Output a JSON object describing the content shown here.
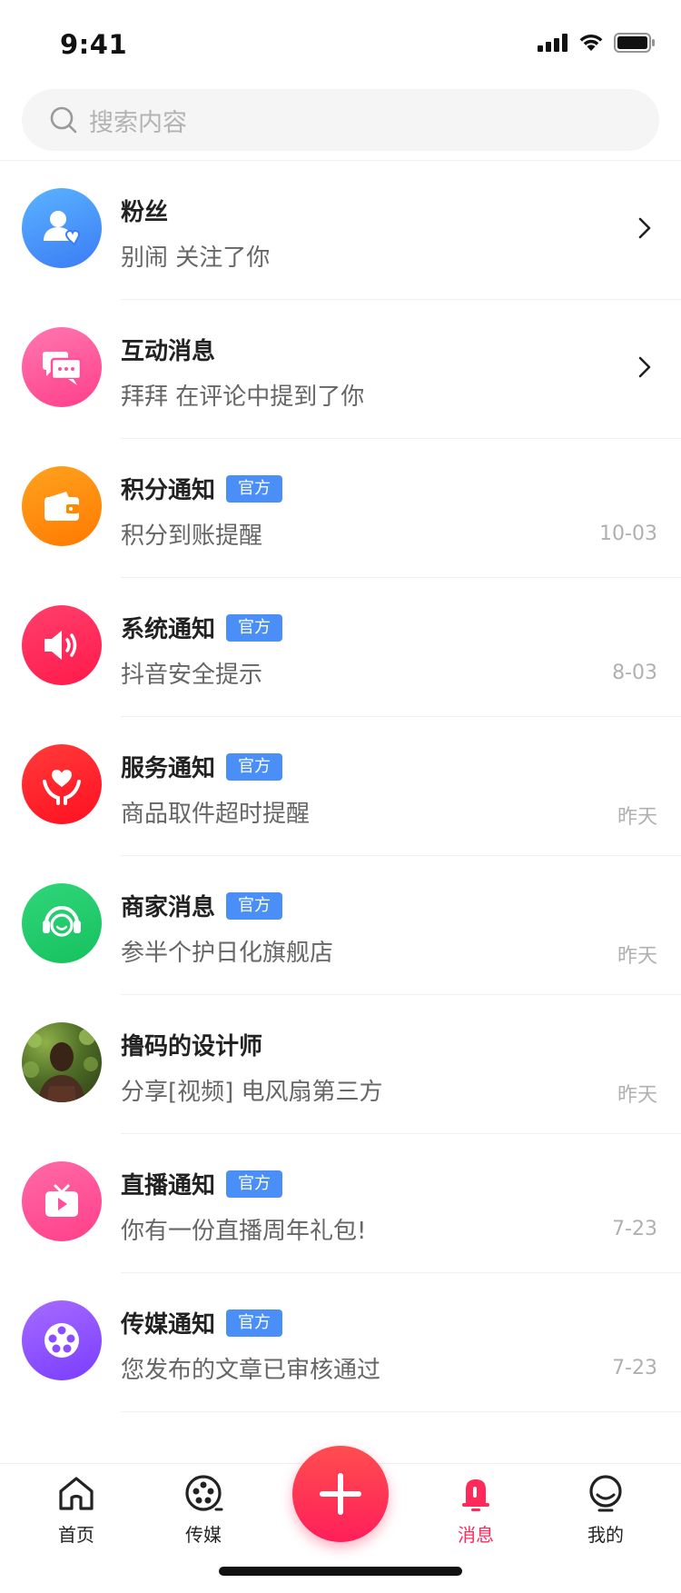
{
  "status_bar": {
    "time": "9:41"
  },
  "search": {
    "placeholder": "搜索内容"
  },
  "messages": [
    {
      "title": "粉丝",
      "subtitle": "别闹 关注了你",
      "badge": "",
      "time": "",
      "icon": "fans-icon",
      "color": "#4a8ff7",
      "chevron": true
    },
    {
      "title": "互动消息",
      "subtitle": "拜拜 在评论中提到了你",
      "badge": "",
      "time": "",
      "icon": "chat-icon",
      "color": "#ff4f9a",
      "chevron": true
    },
    {
      "title": "积分通知",
      "subtitle": "积分到账提醒",
      "badge": "官方",
      "time": "10-03",
      "icon": "wallet-icon",
      "color": "#ff8a00",
      "chevron": false
    },
    {
      "title": "系统通知",
      "subtitle": "抖音安全提示",
      "badge": "官方",
      "time": "8-03",
      "icon": "speaker-icon",
      "color": "#ff2a5a",
      "chevron": false
    },
    {
      "title": "服务通知",
      "subtitle": "商品取件超时提醒",
      "badge": "官方",
      "time": "昨天",
      "icon": "heart-hands-icon",
      "color": "#ff1f2e",
      "chevron": false
    },
    {
      "title": "商家消息",
      "subtitle": "参半个护日化旗舰店",
      "badge": "官方",
      "time": "昨天",
      "icon": "headset-icon",
      "color": "#1fc86a",
      "chevron": false
    },
    {
      "title": "撸码的设计师",
      "subtitle": "分享[视频] 电风扇第三方",
      "badge": "",
      "time": "昨天",
      "icon": "user-photo-avatar",
      "color": "#4b6a2e",
      "chevron": false
    },
    {
      "title": "直播通知",
      "subtitle": "你有一份直播周年礼包!",
      "badge": "官方",
      "time": "7-23",
      "icon": "tv-icon",
      "color": "#ff4f9a",
      "chevron": false
    },
    {
      "title": "传媒通知",
      "subtitle": "您发布的文章已审核通过",
      "badge": "官方",
      "time": "7-23",
      "icon": "film-reel-icon",
      "color": "#8a4dff",
      "chevron": false
    }
  ],
  "tabbar": {
    "home": "首页",
    "media": "传媒",
    "messages": "消息",
    "mine": "我的",
    "active": "messages",
    "accent": "#ff2a5a"
  }
}
